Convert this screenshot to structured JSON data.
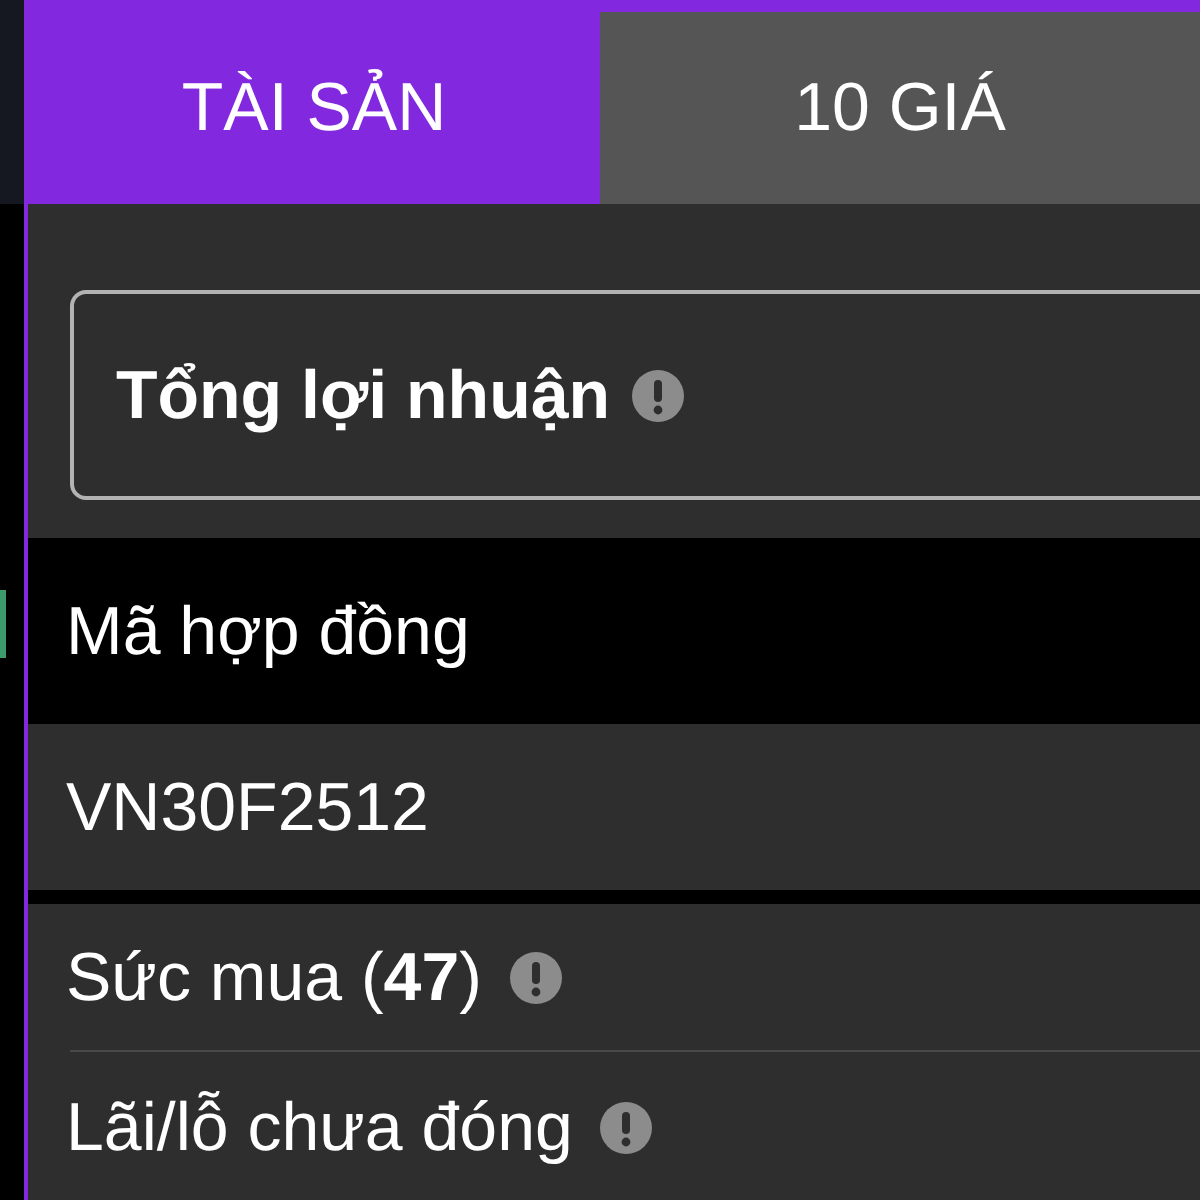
{
  "tabs": [
    {
      "label": "TÀI SẢN",
      "selected": true
    },
    {
      "label": "10 GIÁ",
      "selected": false
    }
  ],
  "summary_card": {
    "title": "Tổng lợi nhuận"
  },
  "contracts_table": {
    "columns": [
      "Mã hợp đồng"
    ],
    "rows": [
      [
        "VN30F2512"
      ]
    ]
  },
  "metrics": [
    {
      "label": "Sức mua (**47**)"
    },
    {
      "label": "Lãi/lỗ chưa đóng"
    }
  ]
}
